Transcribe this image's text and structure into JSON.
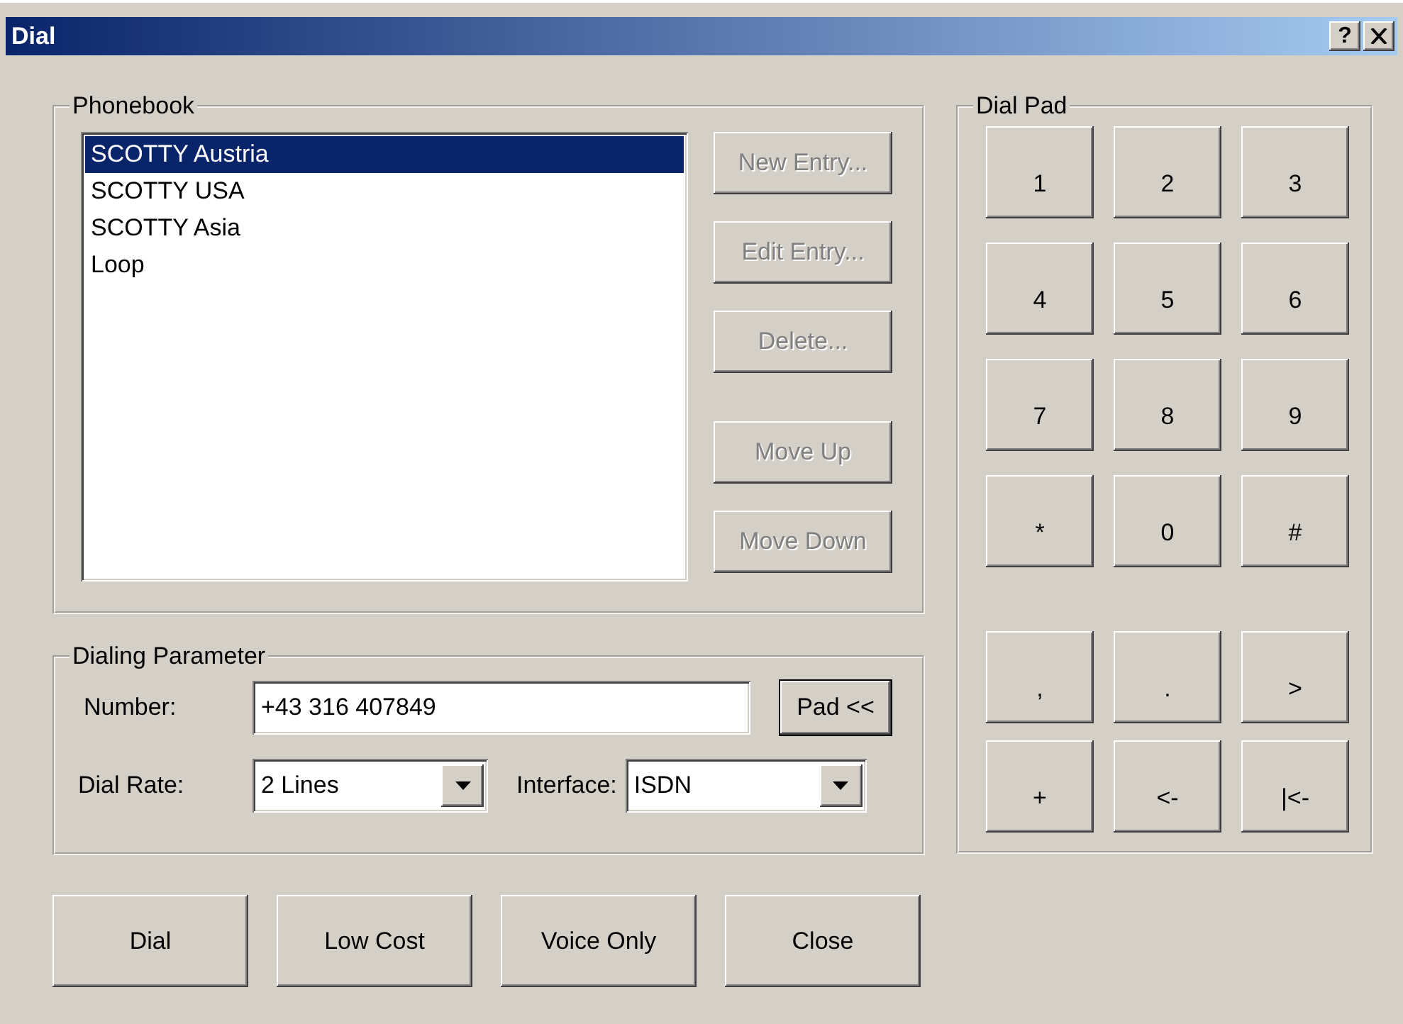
{
  "window": {
    "title": "Dial",
    "help_button": "?"
  },
  "phonebook": {
    "title": "Phonebook",
    "entries": [
      {
        "label": "SCOTTY Austria",
        "selected": true
      },
      {
        "label": "SCOTTY USA",
        "selected": false
      },
      {
        "label": "SCOTTY Asia",
        "selected": false
      },
      {
        "label": "Loop",
        "selected": false
      }
    ],
    "buttons": [
      {
        "label": "New Entry...",
        "disabled": true
      },
      {
        "label": "Edit Entry...",
        "disabled": true
      },
      {
        "label": "Delete...",
        "disabled": true
      },
      {
        "label": "Move Up",
        "disabled": true
      },
      {
        "label": "Move Down",
        "disabled": true
      }
    ]
  },
  "dialing_parameter": {
    "title": "Dialing Parameter",
    "number_label": "Number:",
    "number_value": "+43 316 407849",
    "pad_button": "Pad <<",
    "dial_rate_label": "Dial Rate:",
    "dial_rate_value": "2 Lines",
    "interface_label": "Interface:",
    "interface_value": "ISDN"
  },
  "actions": [
    "Dial",
    "Low Cost",
    "Voice Only",
    "Close"
  ],
  "dial_pad": {
    "title": "Dial Pad",
    "keys": [
      [
        "1",
        "2",
        "3"
      ],
      [
        "4",
        "5",
        "6"
      ],
      [
        "7",
        "8",
        "9"
      ],
      [
        "*",
        "0",
        "#"
      ]
    ],
    "extra_keys": [
      [
        ",",
        ".",
        ">"
      ],
      [
        "+",
        "<-",
        "|<-"
      ]
    ]
  }
}
